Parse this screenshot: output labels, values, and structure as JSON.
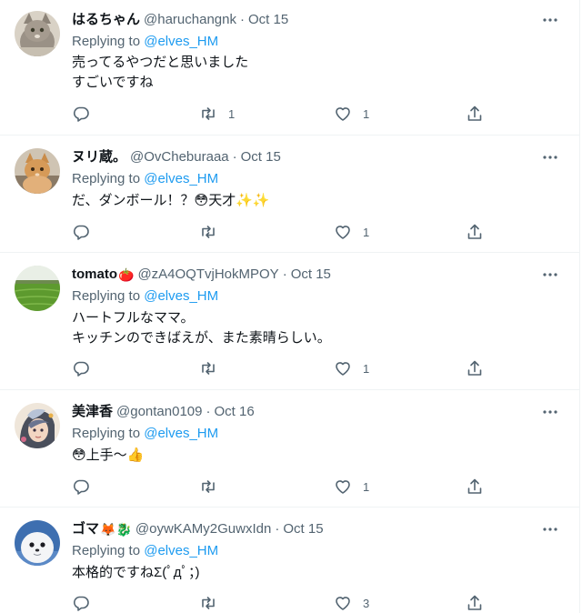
{
  "colors": {
    "text": "#0f1419",
    "secondary": "#536471",
    "link": "#1d9bf0",
    "divider": "#eff3f4"
  },
  "tweets": [
    {
      "name": "はるちゃん",
      "name_emoji": "",
      "handle": "@haruchangnk",
      "separator": "·",
      "date": "Oct 15",
      "replying_prefix": "Replying to",
      "replying_to": "@elves_HM",
      "lines": [
        "売ってるやつだと思いました",
        "すごいですね"
      ],
      "reply_count": "",
      "retweet_count": "1",
      "like_count": "1",
      "avatar": "cat-avatar"
    },
    {
      "name": "ヌリ蔵。",
      "name_emoji": "",
      "handle": "@OvCheburaaa",
      "separator": "·",
      "date": "Oct 15",
      "replying_prefix": "Replying to",
      "replying_to": "@elves_HM",
      "lines": [
        "だ、ダンボール！？😳天才✨✨"
      ],
      "reply_count": "",
      "retweet_count": "",
      "like_count": "1",
      "avatar": "orange-cat-avatar"
    },
    {
      "name": "tomato",
      "name_emoji": "🍅",
      "handle": "@zA4OQTvjHokMPOY",
      "separator": "·",
      "date": "Oct 15",
      "replying_prefix": "Replying to",
      "replying_to": "@elves_HM",
      "lines": [
        "ハートフルなママ。",
        "キッチンのできばえが、また素晴らしい。"
      ],
      "reply_count": "",
      "retweet_count": "",
      "like_count": "1",
      "avatar": "field-avatar"
    },
    {
      "name": "美津香",
      "name_emoji": "",
      "handle": "@gontan0109",
      "separator": "·",
      "date": "Oct 16",
      "replying_prefix": "Replying to",
      "replying_to": "@elves_HM",
      "lines": [
        "😳上手～👍"
      ],
      "reply_count": "",
      "retweet_count": "",
      "like_count": "1",
      "avatar": "illustration-avatar"
    },
    {
      "name": "ゴマ",
      "name_emoji": "🦊🐉",
      "handle": "@oywKAMy2GuwxIdn",
      "separator": "·",
      "date": "Oct 15",
      "replying_prefix": "Replying to",
      "replying_to": "@elves_HM",
      "lines": [
        "本格的ですねΣ(ﾟдﾟ；)"
      ],
      "reply_count": "",
      "retweet_count": "",
      "like_count": "3",
      "avatar": "seal-avatar"
    }
  ],
  "icons": {
    "more": "more-horizontal-icon",
    "reply": "reply-icon",
    "retweet": "retweet-icon",
    "like": "heart-icon",
    "share": "share-icon"
  }
}
